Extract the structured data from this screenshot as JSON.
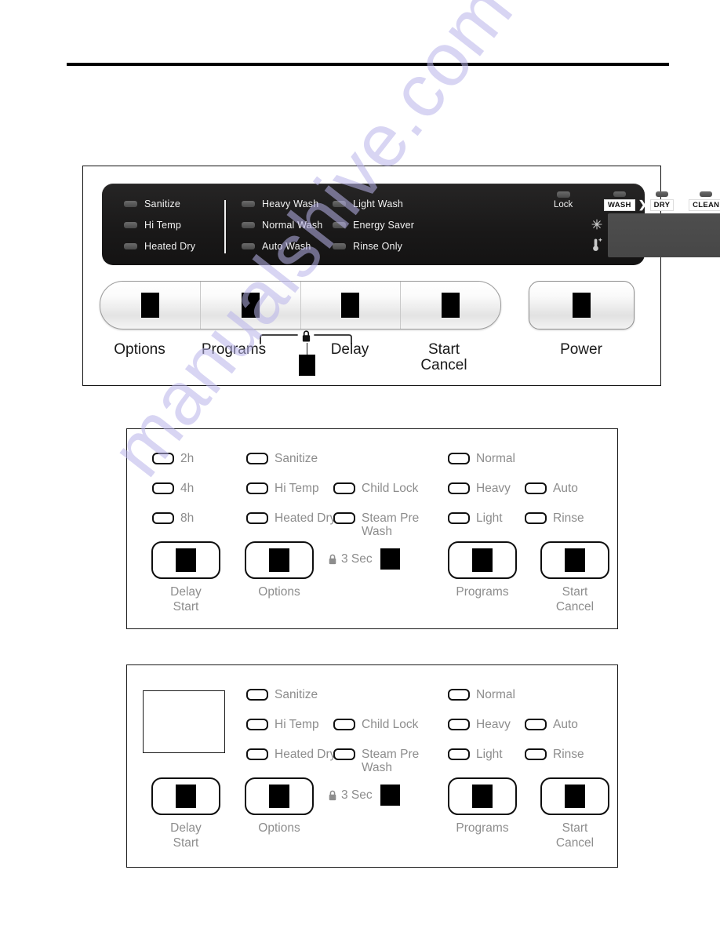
{
  "page": {
    "watermark": "manualshive.com"
  },
  "photo_panel": {
    "name": "dishwasher-control-panel-photo",
    "indicator_groups": {
      "options": [
        {
          "label": "Sanitize",
          "icon": "led-indicator"
        },
        {
          "label": "Hi Temp",
          "icon": "led-indicator"
        },
        {
          "label": "Heated Dry",
          "icon": "led-indicator"
        }
      ],
      "programs_left": [
        {
          "label": "Heavy Wash",
          "icon": "led-indicator"
        },
        {
          "label": "Normal  Wash",
          "icon": "led-indicator"
        },
        {
          "label": "Auto Wash",
          "icon": "led-indicator"
        }
      ],
      "programs_right": [
        {
          "label": "Light Wash",
          "icon": "led-indicator"
        },
        {
          "label": "Energy Saver",
          "icon": "led-indicator"
        },
        {
          "label": "Rinse Only",
          "icon": "led-indicator"
        }
      ]
    },
    "lock": {
      "label": "Lock",
      "icon": "led-indicator"
    },
    "cycle_progress": {
      "steps": [
        "WASH",
        "DRY",
        "CLEAN"
      ],
      "arrow": "❯"
    },
    "status_icons": [
      {
        "name": "sanitize-sun-icon"
      },
      {
        "name": "hi-temp-thermometer-icon"
      }
    ],
    "display": {
      "name": "digital-display",
      "value": ""
    },
    "buttons": [
      {
        "label": "Options",
        "icon": "redacted-marker"
      },
      {
        "label": "Programs",
        "icon": "redacted-marker"
      },
      {
        "label": "Delay",
        "icon": "redacted-marker"
      },
      {
        "label": "Start\nCancel",
        "line1": "Start",
        "line2": "Cancel",
        "icon": "redacted-marker"
      },
      {
        "label": "Power",
        "icon": "redacted-marker"
      }
    ],
    "child_lock_hint": {
      "icon": "padlock-icon",
      "label": ""
    }
  },
  "diagram_mid": {
    "name": "control-panel-diagram-with-delay",
    "delay_options": [
      {
        "label": "2h"
      },
      {
        "label": "4h"
      },
      {
        "label": "8h"
      }
    ],
    "option_indicators": [
      {
        "label": "Sanitize"
      },
      {
        "label": "Hi Temp"
      },
      {
        "label": "Heated Dry"
      }
    ],
    "extra_indicators": [
      {
        "label": "Child Lock"
      },
      {
        "label": "Steam Pre Wash"
      }
    ],
    "program_indicators_left": [
      {
        "label": "Normal"
      },
      {
        "label": "Heavy"
      },
      {
        "label": "Light"
      }
    ],
    "program_indicators_right": [
      {
        "label": "Auto"
      },
      {
        "label": "Rinse"
      }
    ],
    "buttons": [
      {
        "line1": "Delay",
        "line2": "Start"
      },
      {
        "line1": "Options",
        "line2": ""
      },
      {
        "line1": "Programs",
        "line2": ""
      },
      {
        "line1": "Start",
        "line2": "Cancel"
      }
    ],
    "hold_hint": {
      "icon": "padlock-icon",
      "label": "3 Sec"
    }
  },
  "diagram_bot": {
    "name": "control-panel-diagram-without-delay",
    "blank_region": "",
    "option_indicators": [
      {
        "label": "Sanitize"
      },
      {
        "label": "Hi Temp"
      },
      {
        "label": "Heated Dry"
      }
    ],
    "extra_indicators": [
      {
        "label": "Child Lock"
      },
      {
        "label": "Steam Pre Wash"
      }
    ],
    "program_indicators_left": [
      {
        "label": "Normal"
      },
      {
        "label": "Heavy"
      },
      {
        "label": "Light"
      }
    ],
    "program_indicators_right": [
      {
        "label": "Auto"
      },
      {
        "label": "Rinse"
      }
    ],
    "buttons": [
      {
        "line1": "Delay",
        "line2": "Start"
      },
      {
        "line1": "Options",
        "line2": ""
      },
      {
        "line1": "Programs",
        "line2": ""
      },
      {
        "line1": "Start",
        "line2": "Cancel"
      }
    ],
    "hold_hint": {
      "icon": "padlock-icon",
      "label": "3 Sec"
    }
  },
  "colors": {
    "panel_black": "#1d1c1c",
    "led_gray": "#5b5b5b",
    "label_gray": "#8d8d8d",
    "watermark": "#b9b4ea"
  }
}
